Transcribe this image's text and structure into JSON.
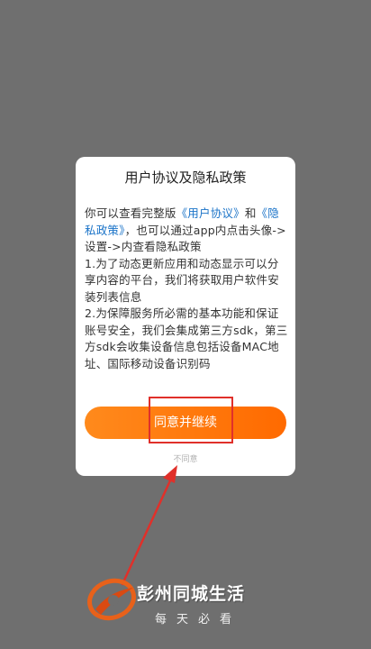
{
  "dialog": {
    "title": "用户协议及隐私政策",
    "intro_prefix": "你可以查看完整版",
    "user_agreement_link": "《用户协议》",
    "intro_and": "和",
    "privacy_link": "《隐私政策》",
    "intro_suffix": "，也可以通过app内点击头像->设置->内查看隐私政策",
    "item1": "1.为了动态更新应用和动态显示可以分享内容的平台，我们将获取用户软件安装列表信息",
    "item2": "2.为保障服务所必需的基本功能和保证账号安全，我们会集成第三方sdk，第三方sdk会收集设备信息包括设备MAC地址、国际移动设备识别码",
    "agree_button": "同意并继续",
    "disagree_link": "不同意"
  },
  "watermark": {
    "name": "彭州同城生活",
    "slogan": "每天必看"
  },
  "colors": {
    "overlay": "#6f6f6f",
    "accent": "#ff7a0f",
    "link": "#1a73c8",
    "annotation": "#e0302a"
  }
}
